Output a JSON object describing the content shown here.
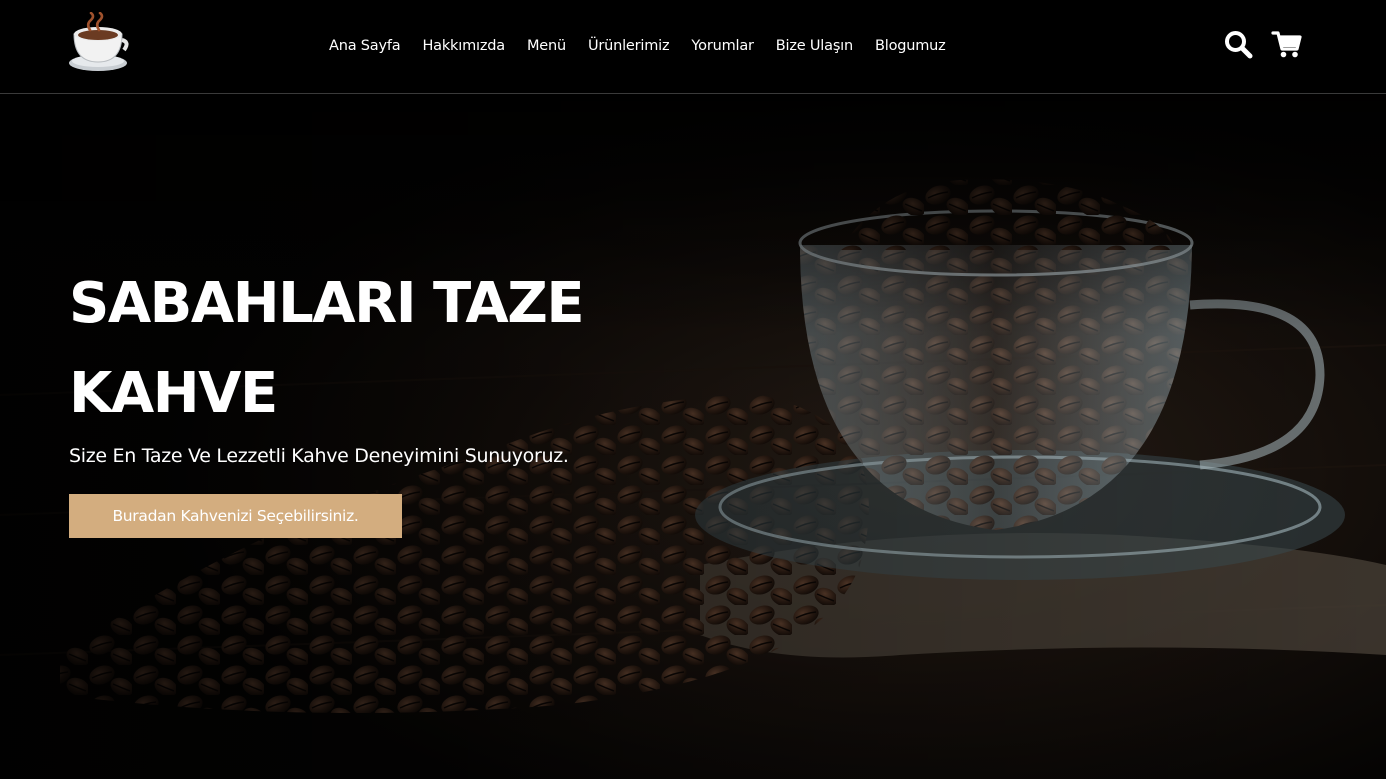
{
  "nav": {
    "items": [
      {
        "label": "Ana Sayfa"
      },
      {
        "label": "Hakkımızda"
      },
      {
        "label": "Menü"
      },
      {
        "label": "Ürünlerimiz"
      },
      {
        "label": "Yorumlar"
      },
      {
        "label": "Bize Ulaşın"
      },
      {
        "label": "Blogumuz"
      }
    ]
  },
  "icons": {
    "logo": "coffee-cup-icon",
    "search": "search-icon",
    "cart": "shopping-cart-icon"
  },
  "hero": {
    "title_line1": "SABAHLARI TAZE",
    "title_line2": "KAHVE",
    "subtitle": "Size En Taze Ve Lezzetli Kahve Deneyimini Sunuyoruz.",
    "cta_label": "Buradan Kahvenizi Seçebilirsiniz."
  },
  "colors": {
    "accent": "#d3ad7f",
    "background": "#000000",
    "text": "#ffffff"
  }
}
